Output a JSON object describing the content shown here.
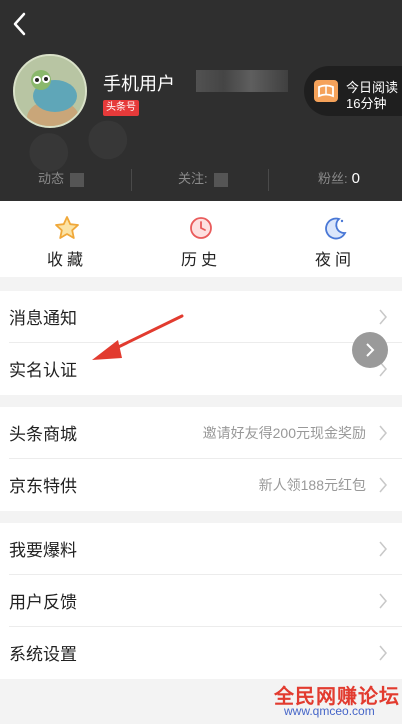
{
  "profile": {
    "username": "手机用户",
    "badge": "头条号",
    "reading": {
      "line1": "今日阅读",
      "line2": "16分钟"
    }
  },
  "stats": [
    {
      "label": "动态",
      "value": ""
    },
    {
      "label": "关注:",
      "value": ""
    },
    {
      "label": "粉丝:",
      "value": "0"
    }
  ],
  "quick_actions": [
    {
      "label": "收藏",
      "icon": "star-icon"
    },
    {
      "label": "历史",
      "icon": "history-clock-icon"
    },
    {
      "label": "夜间",
      "icon": "moon-icon"
    }
  ],
  "menu": {
    "notifications": "消息通知",
    "verification": "实名认证",
    "mall": {
      "label": "头条商城",
      "hint": "邀请好友得200元现金奖励"
    },
    "jd": {
      "label": "京东特供",
      "hint": "新人领188元红包"
    },
    "tip_off": "我要爆料",
    "feedback": "用户反馈",
    "settings": "系统设置"
  },
  "watermark": {
    "line1": "全民网赚论坛",
    "line2": "www.qmceo.com"
  },
  "colors": {
    "header_bg": "#2f2f2f",
    "accent_red": "#e63a3a",
    "reading_orange": "#f5a25a"
  }
}
